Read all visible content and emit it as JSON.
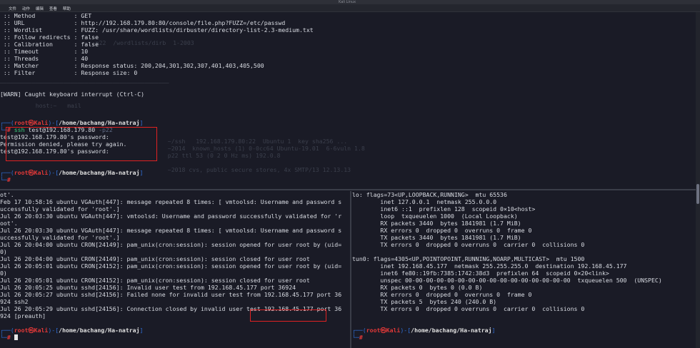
{
  "window": {
    "title": "Kali Linux"
  },
  "menu": [
    "文件",
    "动作",
    "编辑",
    "查看",
    "帮助"
  ],
  "top_pane": {
    "ffuf_config": [
      " :: Method           : GET",
      " :: URL              : http://192.168.179.80:80/console/file.php?FUZZ=/etc/passwd",
      " :: Wordlist         : FUZZ: /usr/share/wordlists/dirbuster/directory-list-2.3-medium.txt",
      " :: Follow redirects : false",
      " :: Calibration      : false",
      " :: Timeout          : 10",
      " :: Threads          : 40",
      " :: Matcher          : Response status: 200,204,301,302,307,401,403,405,500",
      " :: Filter           : Response size: 0"
    ],
    "divider": "________________________________________________",
    "warn": "[WARN] Caught keyboard interrupt (Ctrl-C)",
    "prompt1": {
      "user": "root",
      "skull": "㉿",
      "host": "Kali",
      "path": "/home/bachang/Ha-natraj"
    },
    "ssh_cmd": "ssh",
    "ssh_target": "test@192.168.179.80",
    "ssh_flag": "-p22",
    "ssh_output": [
      "test@192.168.179.80's password:",
      "Permission denied, please try again.",
      "test@192.168.179.80's password:"
    ],
    "prompt2": {
      "user": "root",
      "skull": "㉿",
      "host": "Kali",
      "path": "/home/bachang/Ha-natraj"
    }
  },
  "bottom_left": {
    "lines": [
      "ot'.",
      "Feb 17 10:58:16 ubuntu VGAuth[447]: message repeated 8 times: [ vmtoolsd: Username and password s",
      "uccessfully validated for 'root'.]",
      "Jul 26 20:03:30 ubuntu VGAuth[447]: vmtoolsd: Username and password successfully validated for 'r",
      "oot'.",
      "Jul 26 20:03:30 ubuntu VGAuth[447]: message repeated 8 times: [ vmtoolsd: Username and password s",
      "uccessfully validated for 'root'.]",
      "Jul 26 20:04:00 ubuntu CRON[24149]: pam_unix(cron:session): session opened for user root by (uid=",
      "0)",
      "Jul 26 20:04:00 ubuntu CRON[24149]: pam_unix(cron:session): session closed for user root",
      "Jul 26 20:05:01 ubuntu CRON[24152]: pam_unix(cron:session): session opened for user root by (uid=",
      "0)",
      "Jul 26 20:05:01 ubuntu CRON[24152]: pam_unix(cron:session): session closed for user root",
      "Jul 26 20:05:25 ubuntu sshd[24156]: Invalid user test from 192.168.45.177 port 36924",
      "Jul 26 20:05:27 ubuntu sshd[24156]: Failed none for invalid user test from 192.168.45.177 port 36",
      "924 ssh2",
      "Jul 26 20:05:29 ubuntu sshd[24156]: Connection closed by invalid user test 192.168.45.177 port 36",
      "924 [preauth]"
    ],
    "prompt": {
      "user": "root",
      "skull": "㉿",
      "host": "Kali",
      "path": "/home/bachang/Ha-natraj"
    }
  },
  "bottom_right": {
    "lines": [
      "lo: flags=73<UP,LOOPBACK,RUNNING>  mtu 65536",
      "        inet 127.0.0.1  netmask 255.0.0.0",
      "        inet6 ::1  prefixlen 128  scopeid 0×10<host>",
      "        loop  txqueuelen 1000  (Local Loopback)",
      "        RX packets 3440  bytes 1841981 (1.7 MiB)",
      "        RX errors 0  dropped 0  overruns 0  frame 0",
      "        TX packets 3440  bytes 1841981 (1.7 MiB)",
      "        TX errors 0  dropped 0 overruns 0  carrier 0  collisions 0",
      "",
      "tun0: flags=4305<UP,POINTOPOINT,RUNNING,NOARP,MULTICAST>  mtu 1500",
      "        inet 192.168.45.177  netmask 255.255.255.0  destination 192.168.45.177",
      "        inet6 fe80::19fb:7385:1742:38d3  prefixlen 64  scopeid 0×20<link>",
      "        unspec 00-00-00-00-00-00-00-00-00-00-00-00-00-00-00-00  txqueuelen 500  (UNSPEC)",
      "        RX packets 0  bytes 0 (0.0 B)",
      "        RX errors 0  dropped 0  overruns 0  frame 0",
      "        TX packets 5  bytes 240 (240.0 B)",
      "        TX errors 0  dropped 0 overruns 0  carrier 0  collisions 0"
    ],
    "prompt": {
      "user": "root",
      "skull": "㉿",
      "host": "Kali",
      "path": "/home/bachang/Ha-natraj"
    }
  }
}
